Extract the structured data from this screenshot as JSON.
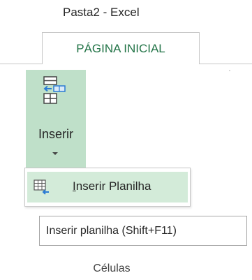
{
  "window": {
    "title": "Pasta2 - Excel"
  },
  "ribbon": {
    "active_tab": "PÁGINA INICIAL",
    "group_label": "Células"
  },
  "inserir": {
    "label": "Inserir",
    "icon": "insert-cells-icon"
  },
  "menu": {
    "items": [
      {
        "underline_char": "I",
        "rest": "nserir Planilha",
        "icon": "insert-sheet-icon"
      }
    ]
  },
  "tooltip": {
    "text": "Inserir planilha (Shift+F11)"
  },
  "colors": {
    "excel_green": "#217346",
    "button_highlight": "#bfe0c9",
    "menu_highlight": "#d3ebd9",
    "border": "#c6c6c6",
    "arrow_blue": "#2b7bd4"
  }
}
